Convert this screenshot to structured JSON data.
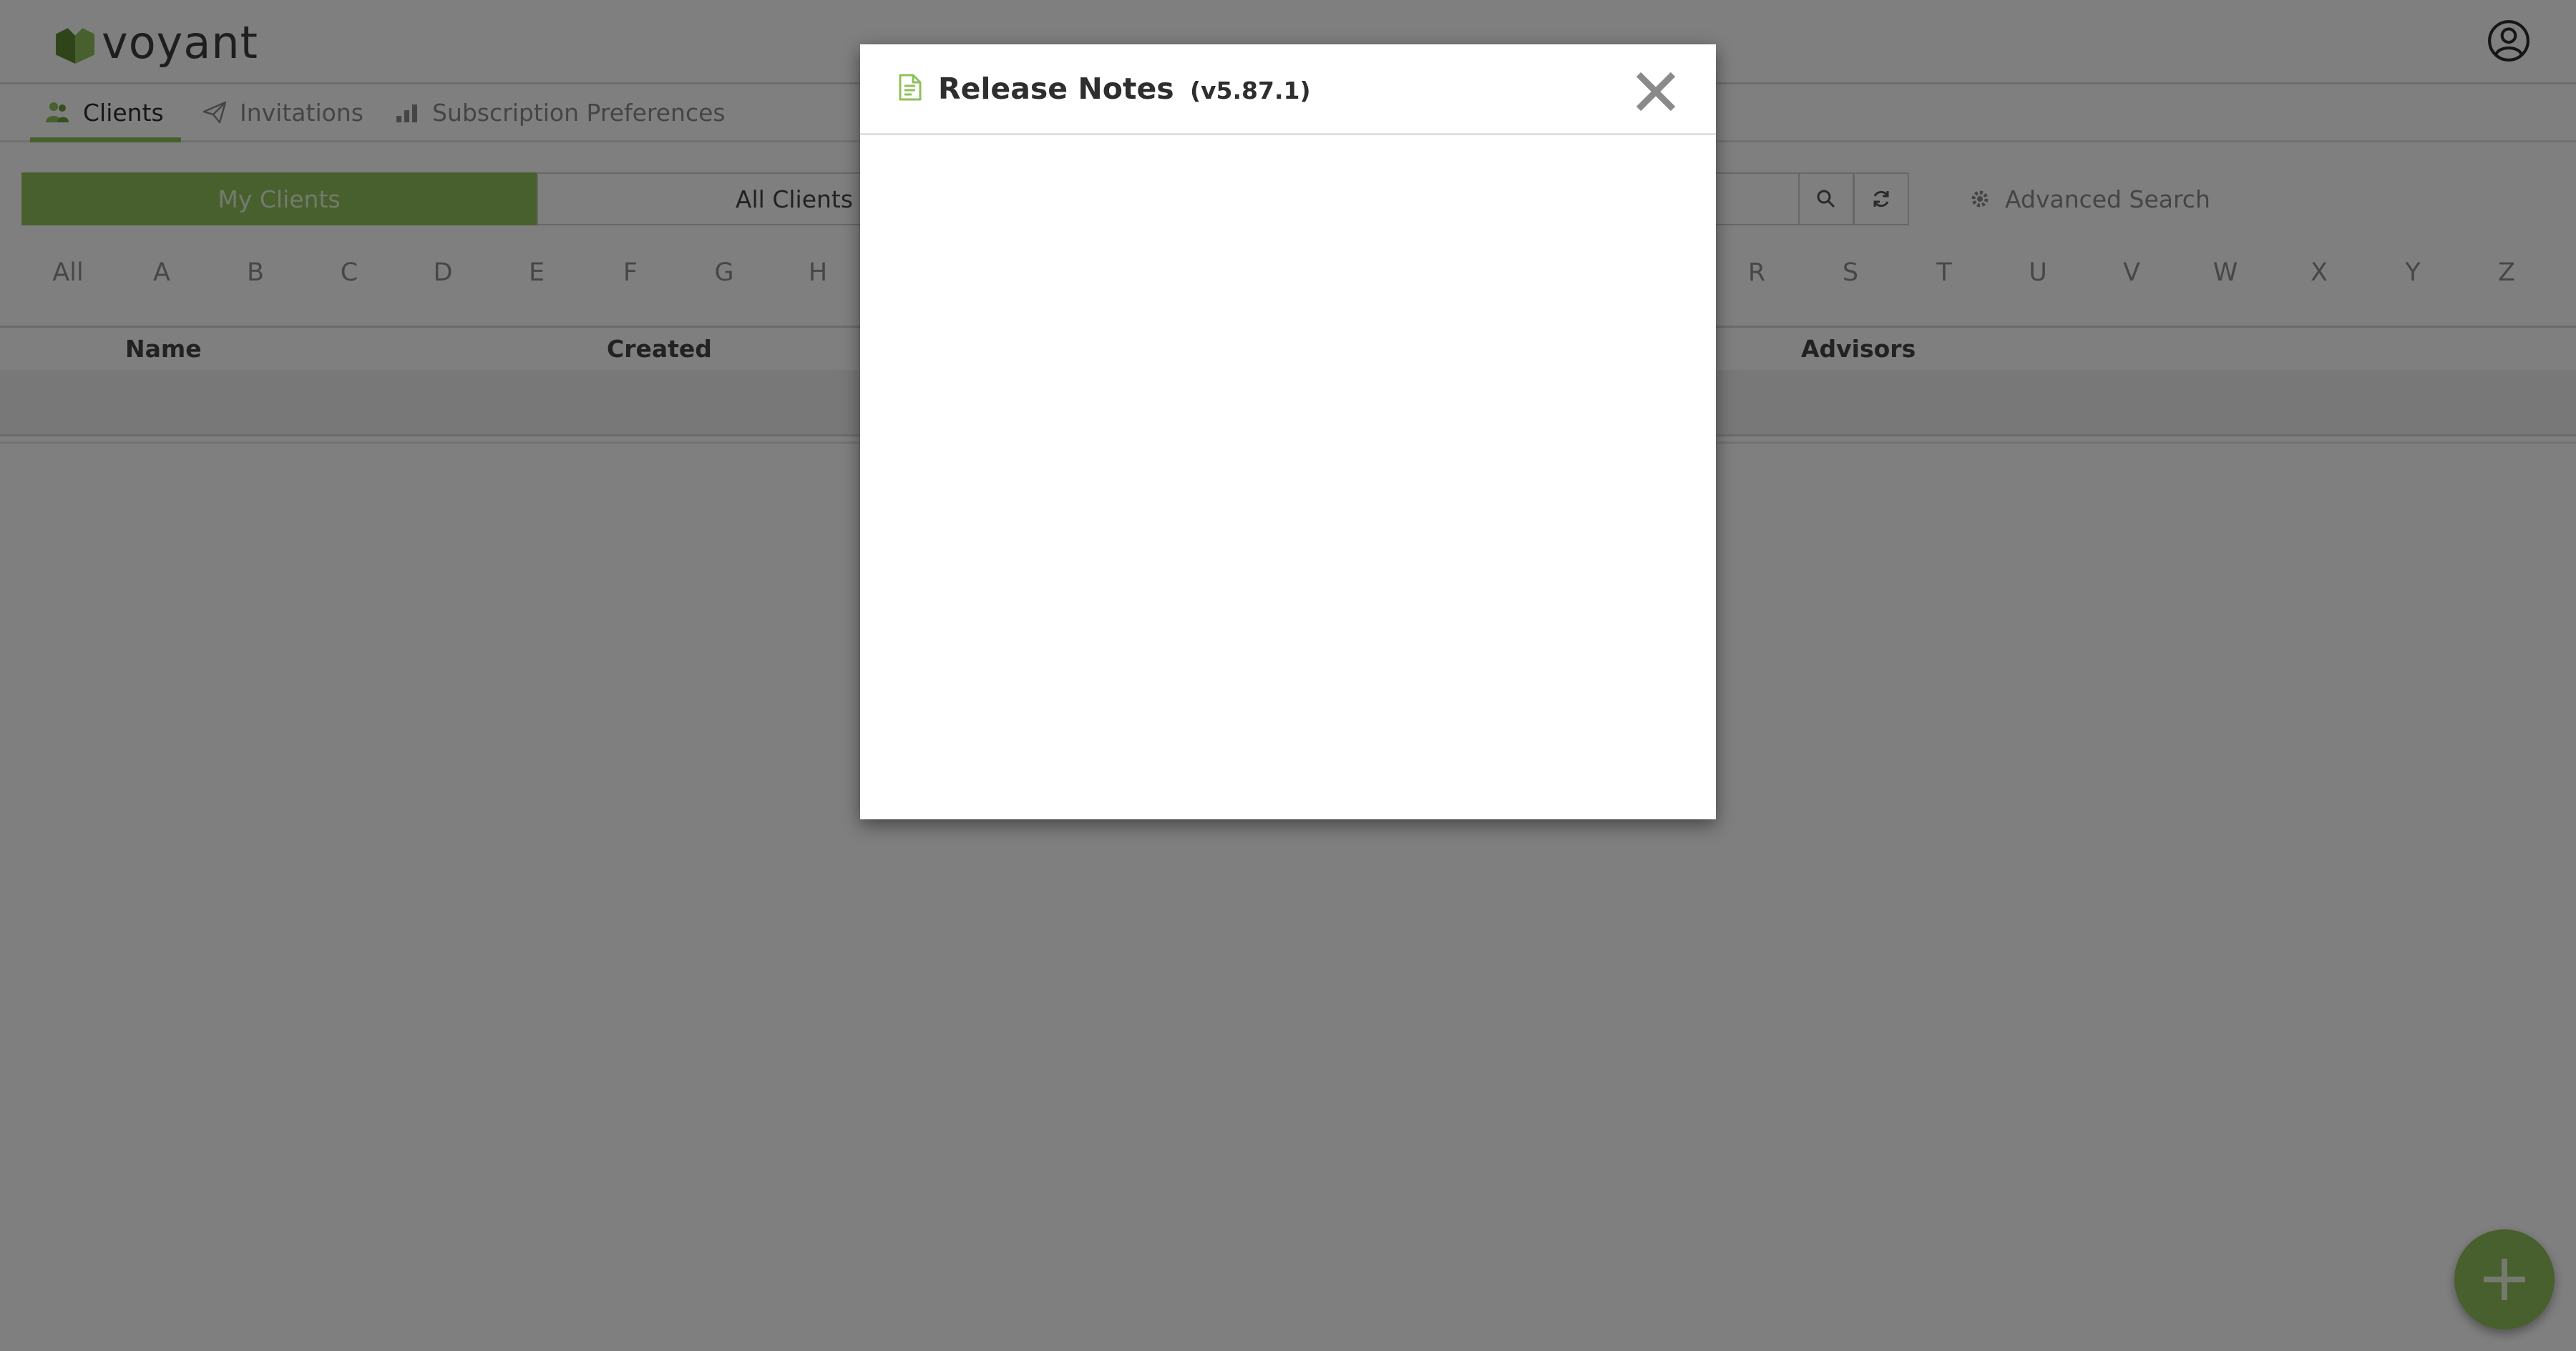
{
  "app": {
    "brand": "voyant",
    "accent_color": "#8fc05a"
  },
  "tabs": [
    {
      "label": "Clients",
      "icon": "clients-icon",
      "active": true
    },
    {
      "label": "Invitations",
      "icon": "paper-plane-icon",
      "active": false
    },
    {
      "label": "Subscription Preferences",
      "icon": "bar-chart-icon",
      "active": false
    }
  ],
  "filters": {
    "my_clients": "My Clients",
    "all_clients": "All Clients",
    "search_value": "",
    "advanced_search": "Advanced Search"
  },
  "alphabet": [
    "All",
    "A",
    "B",
    "C",
    "D",
    "E",
    "F",
    "G",
    "H",
    "R",
    "S",
    "T",
    "U",
    "V",
    "W",
    "X",
    "Y",
    "Z"
  ],
  "table": {
    "columns": [
      "Name",
      "Created",
      "Advisors"
    ]
  },
  "modal": {
    "title": "Release Notes",
    "version": "(v5.87.1)"
  },
  "fab": {
    "icon": "plus-icon"
  }
}
